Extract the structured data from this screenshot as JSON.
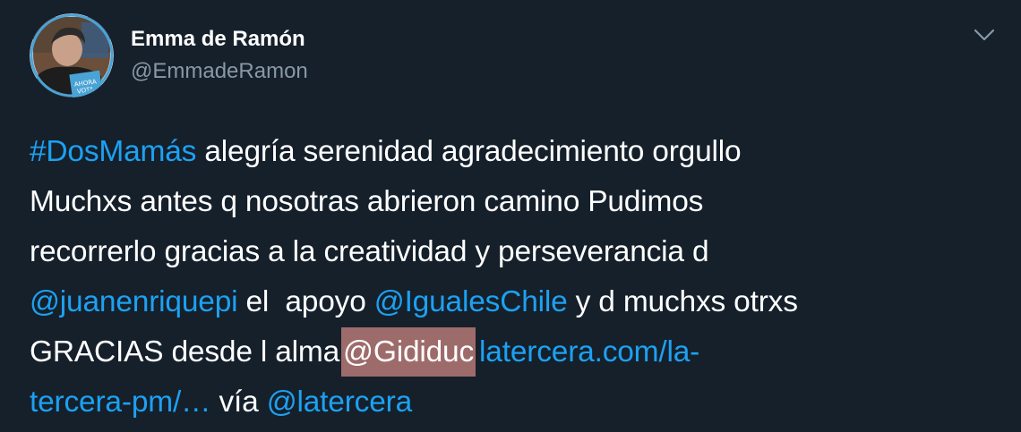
{
  "tweet": {
    "display_name": "Emma de Ramón",
    "handle": "@EmmadeRamon",
    "avatar_icon": "profile-photo",
    "menu_icon": "chevron-down-icon",
    "lines": [
      [
        {
          "text": "#DosMamás",
          "link": true
        },
        {
          "text": " alegría serenidad agradecimiento orgullo",
          "link": false
        }
      ],
      [
        {
          "text": "Muchxs antes q nosotras abrieron camino Pudimos",
          "link": false
        }
      ],
      [
        {
          "text": "recorrerlo gracias a la creatividad y perseverancia d",
          "link": false
        }
      ],
      [
        {
          "text": "@juanenriquepi",
          "link": true
        },
        {
          "text": " el  apoyo ",
          "link": false
        },
        {
          "text": "@IgualesChile",
          "link": true
        },
        {
          "text": " y d muchxs otrxs",
          "link": false
        }
      ],
      [
        {
          "text": "GRACIAS desde l alma",
          "link": false
        },
        {
          "text": "@Gididuc",
          "link": false,
          "highlight": true
        },
        {
          "text": "latercera.com/la-",
          "link": true
        }
      ],
      [
        {
          "text": "tercera-pm/…",
          "link": true
        },
        {
          "text": " vía ",
          "link": false
        },
        {
          "text": "@latercera",
          "link": true
        }
      ]
    ],
    "colors": {
      "background": "#15202b",
      "link": "#1da1f2",
      "secondary_text": "#8899a6",
      "highlight": "#9e6b6b"
    }
  }
}
